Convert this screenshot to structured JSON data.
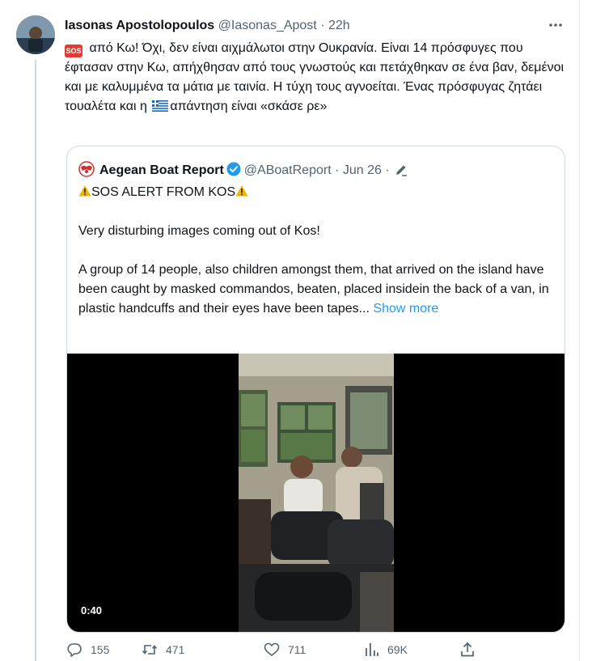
{
  "tweet": {
    "author_name": "Iasonas Apostolopoulos",
    "author_handle": "@Iasonas_Apost",
    "separator": "·",
    "time": "22h",
    "text_emoji_label": "SOS",
    "text_part1": " από Κω! Όχι, δεν είναι αιχμάλωτοι στην Ουκρανία. Είναι 14 πρόσφυγες που έφτασαν στην Κω, απήχθησαν από τους γνωστούς και πετάχθηκαν σε ένα βαν, δεμένοι και με καλυμμένα τα μάτια με ταινία. Η τύχη τους αγνοείται. Ένας πρόσφυγας ζητάει τουαλέτα και η ",
    "text_part2": "απάντηση είναι «σκάσε ρε»"
  },
  "quote": {
    "author_name": "Aegean Boat Report",
    "author_handle": "@ABoatReport",
    "separator": "·",
    "date": "Jun 26",
    "separator2": "·",
    "alert": "SOS ALERT FROM KOS",
    "line2": "Very disturbing images coming out of Kos!",
    "body": "A group of 14 people, also children amongst them, that arrived on the island have been caught by masked commandos, beaten, placed insidein the back of a van, in plastic handcuffs and their eyes have been tapes...",
    "show_more": "Show more",
    "video_duration": "0:40"
  },
  "actions": {
    "replies": "155",
    "retweets": "471",
    "likes": "711",
    "views": "69K"
  },
  "colors": {
    "text": "#0f1419",
    "secondary": "#536471",
    "link": "#1d9bf0",
    "border": "#cfd9de"
  }
}
